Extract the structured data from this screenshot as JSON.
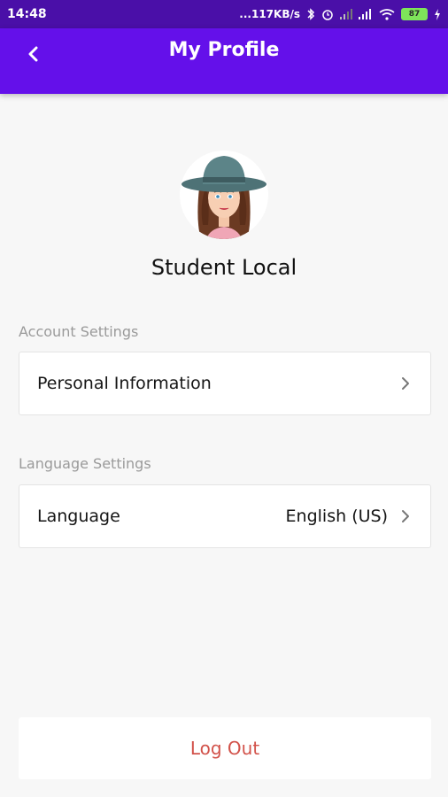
{
  "status_bar": {
    "time": "14:48",
    "network_speed": "...117KB/s",
    "battery_level": "87",
    "icons": [
      "bluetooth-icon",
      "alarm-icon",
      "cell-signal-icon",
      "cell-signal-icon",
      "wifi-icon",
      "battery-icon",
      "charging-icon"
    ]
  },
  "app_bar": {
    "title": "My Profile",
    "back_icon": "chevron-left-icon",
    "color": "#6410ea"
  },
  "profile": {
    "name": "Student Local",
    "avatar": "woman-with-hat-avatar"
  },
  "account_settings": {
    "label": "Account Settings",
    "items": [
      {
        "label": "Personal Information",
        "icon": "chevron-right-icon"
      }
    ]
  },
  "language_settings": {
    "label": "Language Settings",
    "items": [
      {
        "label": "Language",
        "value": "English (US)",
        "icon": "chevron-right-icon"
      }
    ]
  },
  "logout": {
    "label": "Log Out",
    "color": "#d2524a"
  }
}
